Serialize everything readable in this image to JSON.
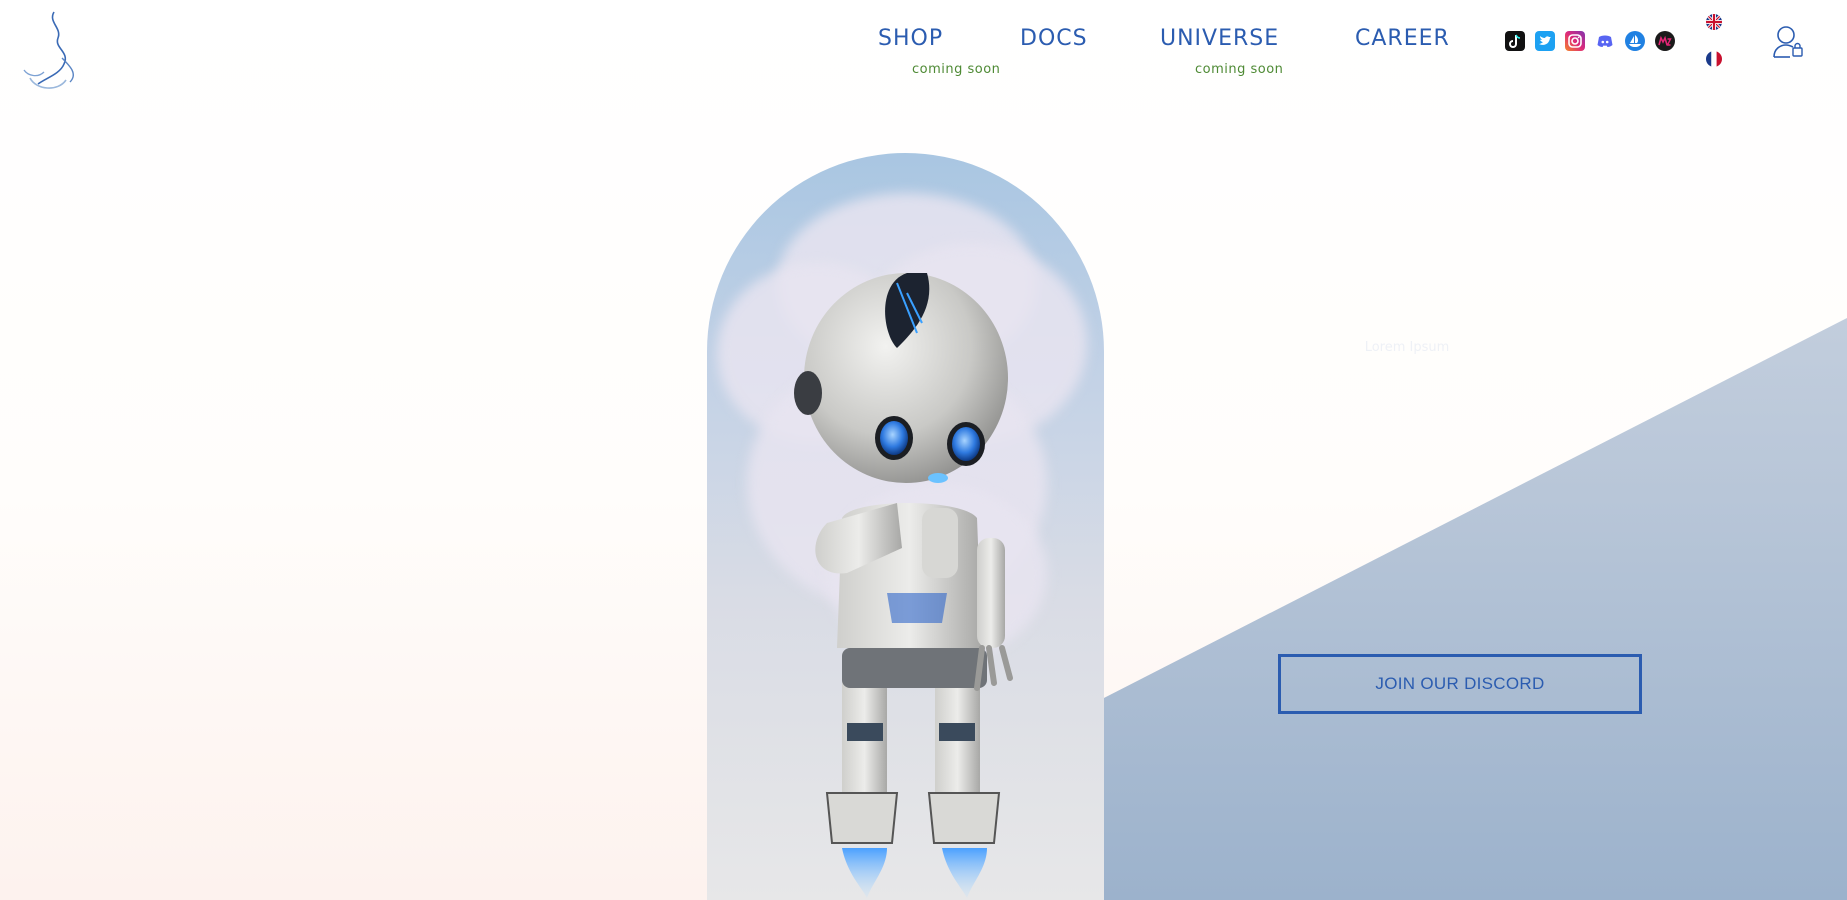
{
  "nav": {
    "items": [
      {
        "label": "SHOP",
        "sub": "coming soon"
      },
      {
        "label": "DOCS",
        "sub": ""
      },
      {
        "label": "UNIVERSE",
        "sub": "coming soon"
      },
      {
        "label": "CAREER",
        "sub": ""
      }
    ]
  },
  "social": [
    {
      "icon": "tiktok-icon",
      "color": "#111111"
    },
    {
      "icon": "twitter-icon",
      "color": "#1da1f2"
    },
    {
      "icon": "instagram-icon",
      "color": "#e1306c"
    },
    {
      "icon": "discord-icon",
      "color": "#5865f2"
    },
    {
      "icon": "opensea-icon",
      "color": "#2081e2"
    },
    {
      "icon": "magic-eden-icon",
      "color": "#1a1a1a"
    }
  ],
  "languages": [
    {
      "icon": "uk-flag-icon"
    },
    {
      "icon": "france-flag-icon"
    }
  ],
  "hero": {
    "faint_text": "Lorem Ipsum",
    "cta_label": "JOIN OUR DISCORD"
  },
  "colors": {
    "accent": "#2b5cb0",
    "coming_soon": "#4e8a34"
  }
}
